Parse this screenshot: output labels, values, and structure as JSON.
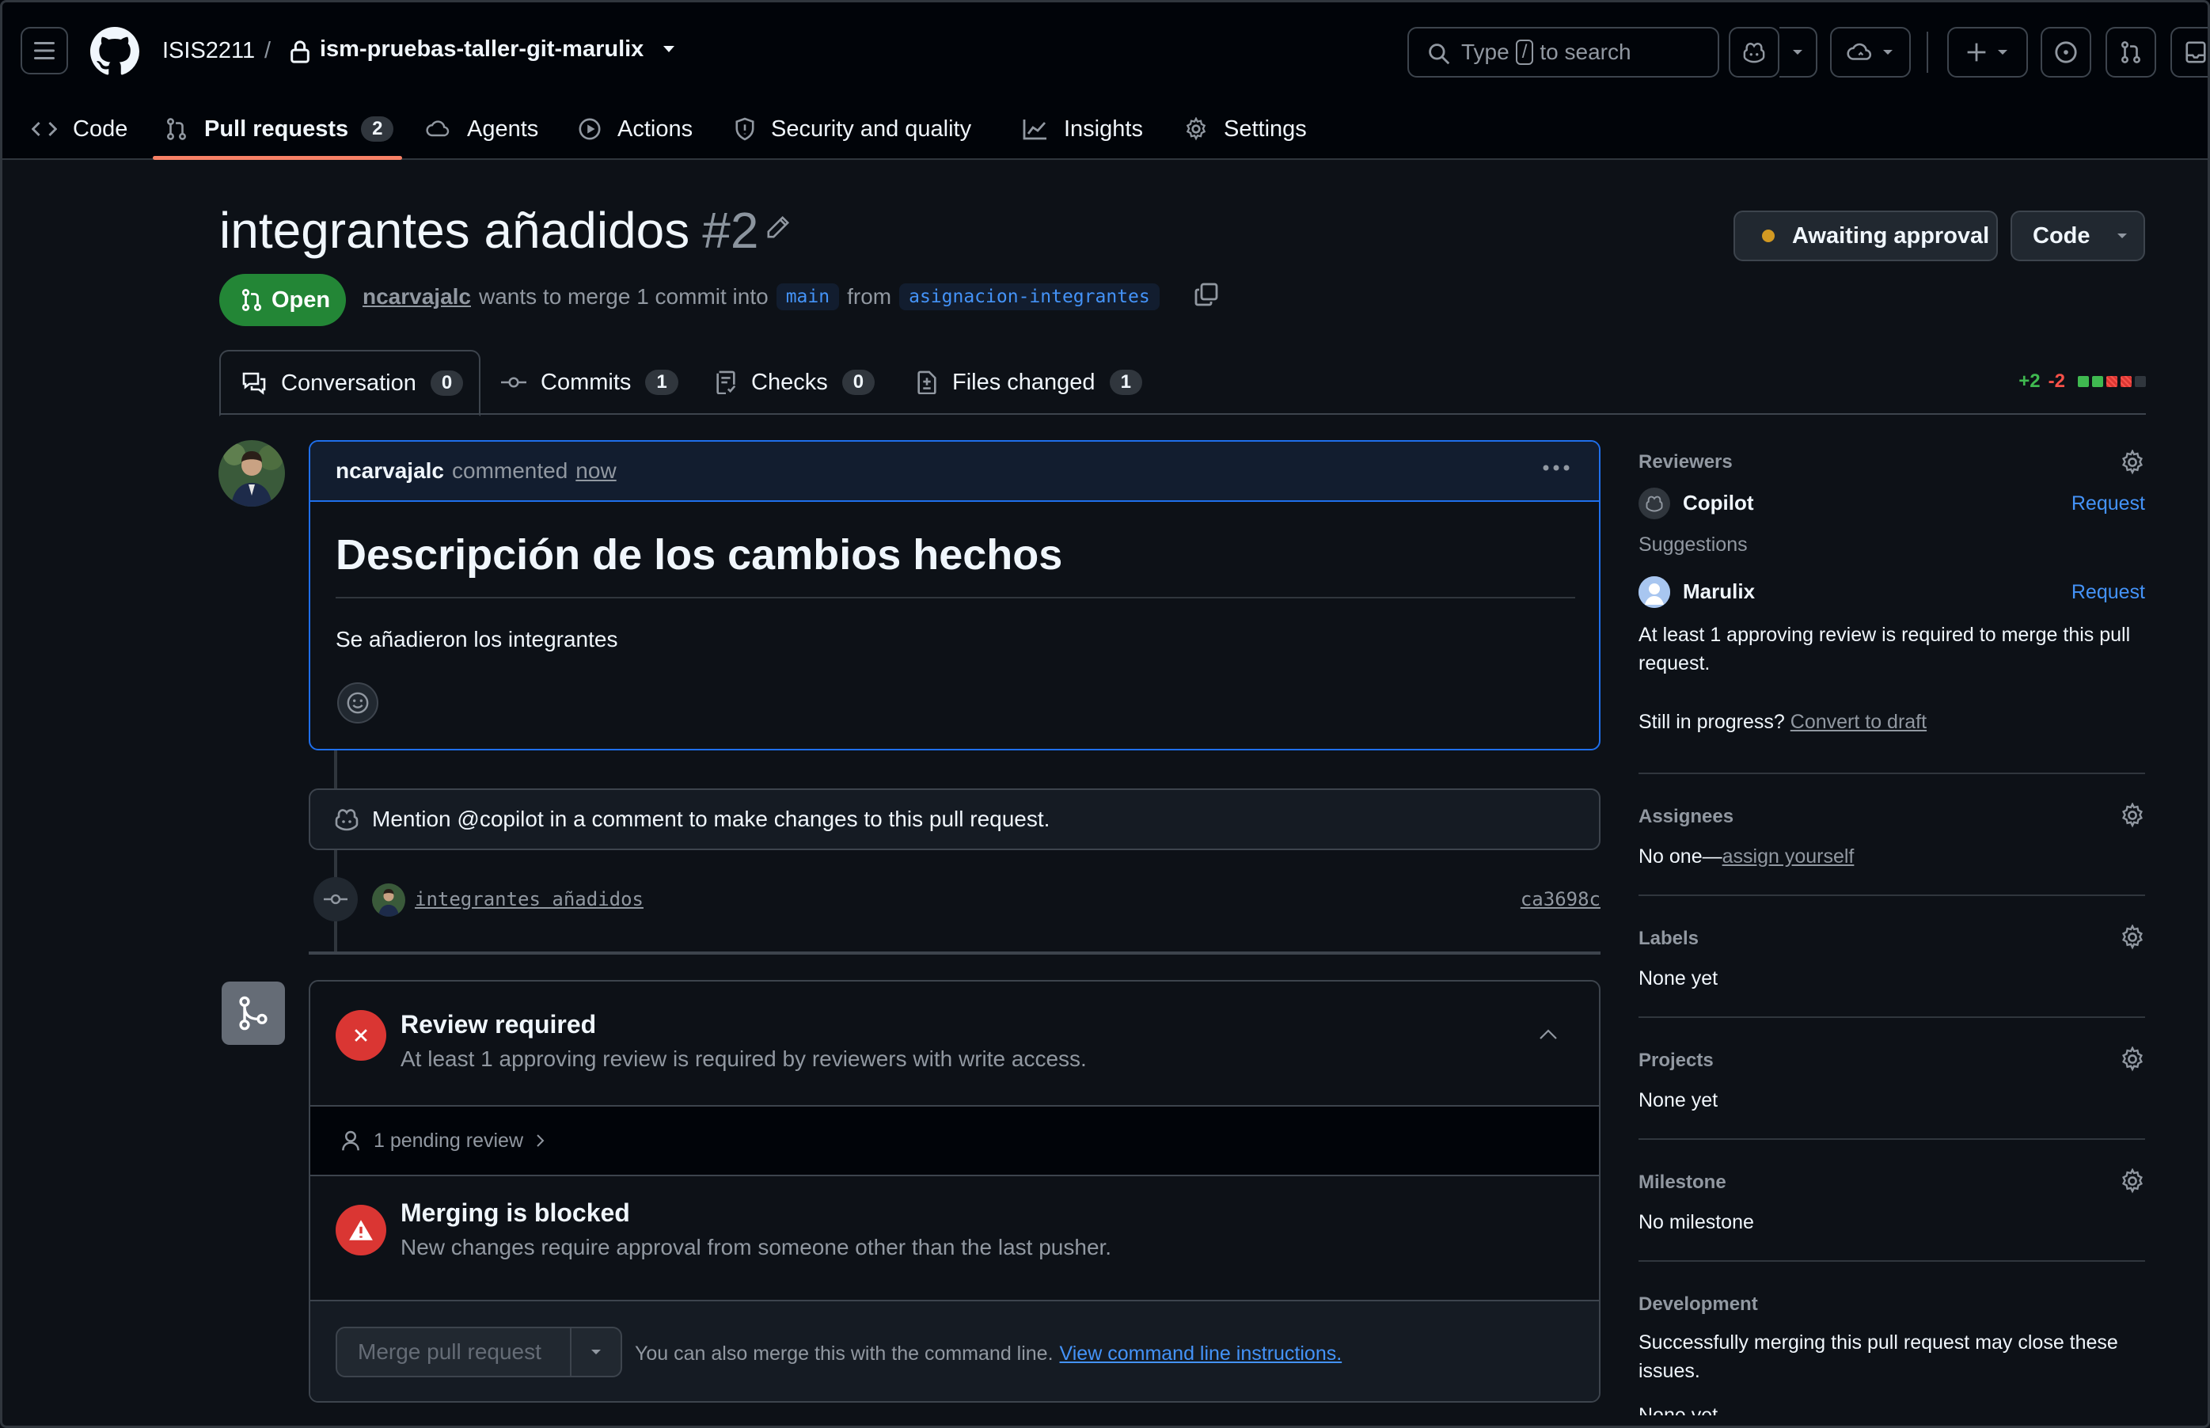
{
  "header": {
    "owner": "ISIS2211",
    "separator": "/",
    "repo": "ism-pruebas-taller-git-marulix",
    "search": {
      "prefix": "Type",
      "key": "/",
      "suffix": "to search"
    }
  },
  "repo_tabs": [
    {
      "label": "Code",
      "icon": "code-icon"
    },
    {
      "label": "Pull requests",
      "icon": "pull-request-icon",
      "count": "2",
      "active": true
    },
    {
      "label": "Agents",
      "icon": "agents-icon"
    },
    {
      "label": "Actions",
      "icon": "play-icon"
    },
    {
      "label": "Security and quality",
      "icon": "shield-icon"
    },
    {
      "label": "Insights",
      "icon": "graph-icon"
    },
    {
      "label": "Settings",
      "icon": "gear-icon"
    }
  ],
  "pr": {
    "title": "integrantes añadidos",
    "number": "#2",
    "awaiting_label": "Awaiting approval",
    "code_button": "Code",
    "state": "Open",
    "author": "ncarvajalc",
    "merge_text": "wants to merge 1 commit into",
    "base_branch": "main",
    "from_text": "from",
    "head_branch": "asignacion-integrantes"
  },
  "pr_tabs": [
    {
      "label": "Conversation",
      "count": "0",
      "icon": "comment-discussion-icon"
    },
    {
      "label": "Commits",
      "count": "1",
      "icon": "commit-icon"
    },
    {
      "label": "Checks",
      "count": "0",
      "icon": "checklist-icon"
    },
    {
      "label": "Files changed",
      "count": "1",
      "icon": "file-diff-icon"
    }
  ],
  "diffstat": {
    "additions": "+2",
    "deletions": "-2",
    "colors": [
      "#3fb950",
      "#3fb950",
      "#da3633",
      "#da3633",
      "#30363d"
    ]
  },
  "comment": {
    "author": "ncarvajalc",
    "action": "commented",
    "time": "now",
    "heading": "Descripción de los cambios hechos",
    "body": "Se añadieron los integrantes"
  },
  "copilot_note": "Mention @copilot in a comment to make changes to this pull request.",
  "commit": {
    "message": "integrantes añadidos",
    "sha": "ca3698c"
  },
  "merge": {
    "review_title": "Review required",
    "review_sub": "At least 1 approving review is required by reviewers with write access.",
    "pending": "1 pending review",
    "blocked_title": "Merging is blocked",
    "blocked_sub": "New changes require approval from someone other than the last pusher.",
    "button": "Merge pull request",
    "hint": "You can also merge this with the command line.",
    "hint_link": "View command line instructions."
  },
  "sidebar": {
    "reviewers": {
      "title": "Reviewers",
      "copilot": "Copilot",
      "request": "Request",
      "suggestions": "Suggestions",
      "suggested": "Marulix",
      "note": "At least 1 approving review is required to merge this pull request.",
      "progress_q": "Still in progress?",
      "draft_link": "Convert to draft"
    },
    "assignees": {
      "title": "Assignees",
      "value": "No one—",
      "link": "assign yourself"
    },
    "labels": {
      "title": "Labels",
      "value": "None yet"
    },
    "projects": {
      "title": "Projects",
      "value": "None yet"
    },
    "milestone": {
      "title": "Milestone",
      "value": "No milestone"
    },
    "development": {
      "title": "Development",
      "value": "Successfully merging this pull request may close these issues.",
      "extra": "None yet"
    }
  }
}
